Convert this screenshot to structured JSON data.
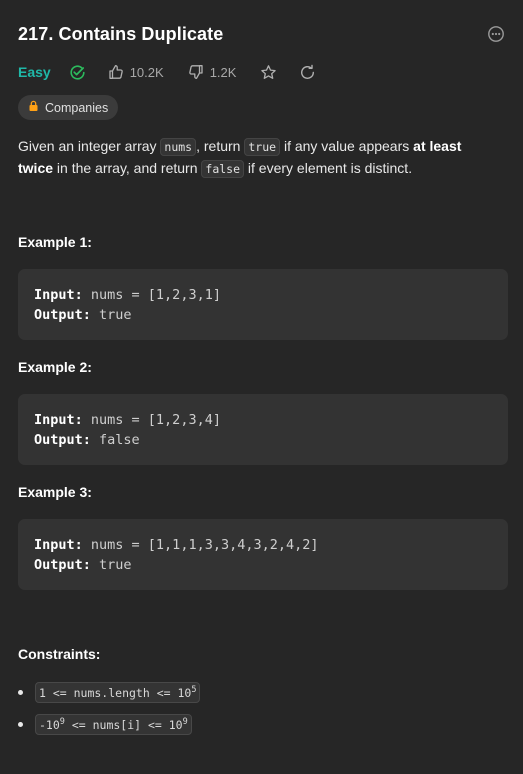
{
  "problem": {
    "title": "217. Contains Duplicate",
    "difficulty": "Easy",
    "likes": "10.2K",
    "dislikes": "1.2K",
    "companies_label": "Companies"
  },
  "description": {
    "p1": "Given an integer array ",
    "c1": "nums",
    "p2": ", return ",
    "c2": "true",
    "p3": " if any value appears ",
    "b1": "at least twice",
    "p4": " in the array, and return ",
    "c3": "false",
    "p5": " if every element is distinct."
  },
  "examples": [
    {
      "title": "Example 1:",
      "input_label": "Input:",
      "input": " nums = [1,2,3,1]",
      "output_label": "Output:",
      "output": " true"
    },
    {
      "title": "Example 2:",
      "input_label": "Input:",
      "input": " nums = [1,2,3,4]",
      "output_label": "Output:",
      "output": " false"
    },
    {
      "title": "Example 3:",
      "input_label": "Input:",
      "input": " nums = [1,1,1,3,3,4,3,2,4,2]",
      "output_label": "Output:",
      "output": " true"
    }
  ],
  "constraints": {
    "title": "Constraints:",
    "items": [
      {
        "pre": "1 <= nums.length <= 10",
        "sup": "5",
        "post": ""
      },
      {
        "pre": "-10",
        "sup": "9",
        "post": " <= nums[i] <= 10",
        "sup2": "9"
      }
    ]
  },
  "colors": {
    "background": "#262626",
    "easy": "#1fb8a8",
    "solved_check": "#2cbb5d",
    "companies_lock": "#ffa116"
  },
  "icons": [
    "more-icon",
    "solved-check-icon",
    "thumbs-up-icon",
    "thumbs-down-icon",
    "star-icon",
    "share-icon",
    "lock-icon"
  ]
}
